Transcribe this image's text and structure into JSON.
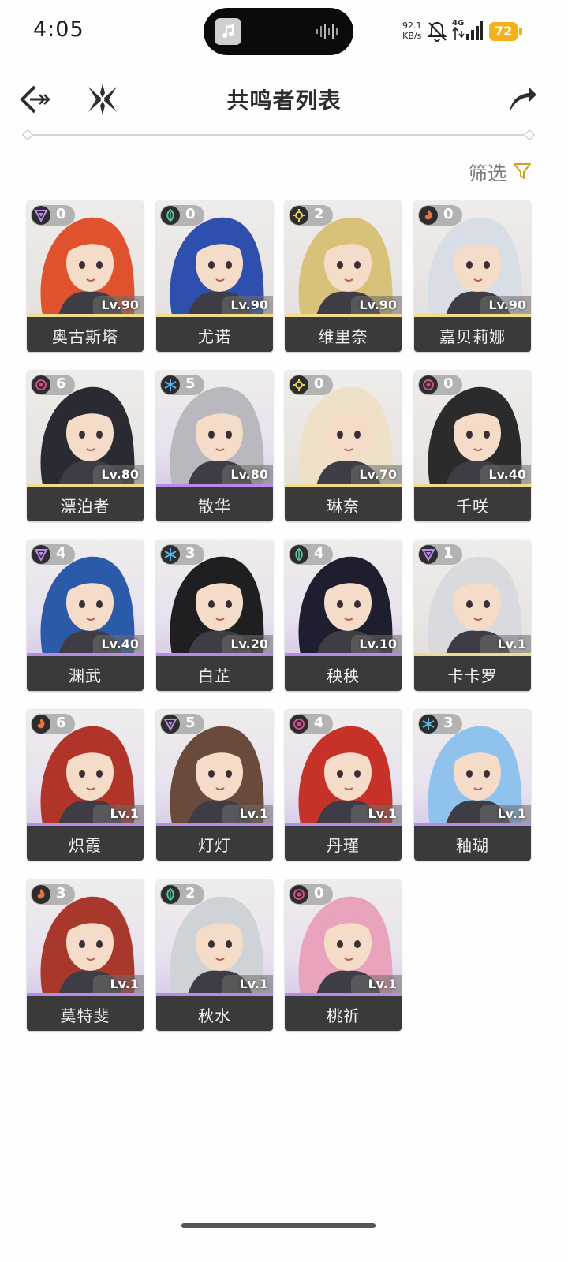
{
  "status_bar": {
    "time": "4:05",
    "net_speed_value": "92.1",
    "net_speed_unit": "KB/s",
    "network": "4G",
    "battery": "72"
  },
  "header": {
    "title": "共鸣者列表"
  },
  "filter": {
    "label": "筛选"
  },
  "colors": {
    "gold_rarity": "#f1dc8e",
    "purple_rarity": "#b48ce8",
    "name_bar": "#3a3a3a",
    "filter_icon": "#c9a227",
    "battery": "#f2b21c"
  },
  "characters": [
    {
      "name": "奥古斯塔",
      "sequence": "0",
      "level": "Lv.90",
      "element": "electro",
      "rarity": "gold"
    },
    {
      "name": "尤诺",
      "sequence": "0",
      "level": "Lv.90",
      "element": "aero",
      "rarity": "gold"
    },
    {
      "name": "维里奈",
      "sequence": "2",
      "level": "Lv.90",
      "element": "spectro",
      "rarity": "gold"
    },
    {
      "name": "嘉贝莉娜",
      "sequence": "0",
      "level": "Lv.90",
      "element": "fusion",
      "rarity": "gold"
    },
    {
      "name": "漂泊者",
      "sequence": "6",
      "level": "Lv.80",
      "element": "havoc",
      "rarity": "gold"
    },
    {
      "name": "散华",
      "sequence": "5",
      "level": "Lv.80",
      "element": "glacio",
      "rarity": "purple"
    },
    {
      "name": "琳奈",
      "sequence": "0",
      "level": "Lv.70",
      "element": "spectro",
      "rarity": "gold"
    },
    {
      "name": "千咲",
      "sequence": "0",
      "level": "Lv.40",
      "element": "havoc",
      "rarity": "gold"
    },
    {
      "name": "渊武",
      "sequence": "4",
      "level": "Lv.40",
      "element": "electro",
      "rarity": "purple"
    },
    {
      "name": "白芷",
      "sequence": "3",
      "level": "Lv.20",
      "element": "glacio",
      "rarity": "purple"
    },
    {
      "name": "秧秧",
      "sequence": "4",
      "level": "Lv.10",
      "element": "aero",
      "rarity": "purple"
    },
    {
      "name": "卡卡罗",
      "sequence": "1",
      "level": "Lv.1",
      "element": "electro",
      "rarity": "gold"
    },
    {
      "name": "炽霞",
      "sequence": "6",
      "level": "Lv.1",
      "element": "fusion",
      "rarity": "purple"
    },
    {
      "name": "灯灯",
      "sequence": "5",
      "level": "Lv.1",
      "element": "electro",
      "rarity": "purple"
    },
    {
      "name": "丹瑾",
      "sequence": "4",
      "level": "Lv.1",
      "element": "havoc",
      "rarity": "purple"
    },
    {
      "name": "釉瑚",
      "sequence": "3",
      "level": "Lv.1",
      "element": "glacio",
      "rarity": "purple"
    },
    {
      "name": "莫特斐",
      "sequence": "3",
      "level": "Lv.1",
      "element": "fusion",
      "rarity": "purple"
    },
    {
      "name": "秋水",
      "sequence": "2",
      "level": "Lv.1",
      "element": "aero",
      "rarity": "purple"
    },
    {
      "name": "桃祈",
      "sequence": "0",
      "level": "Lv.1",
      "element": "havoc",
      "rarity": "purple"
    }
  ]
}
